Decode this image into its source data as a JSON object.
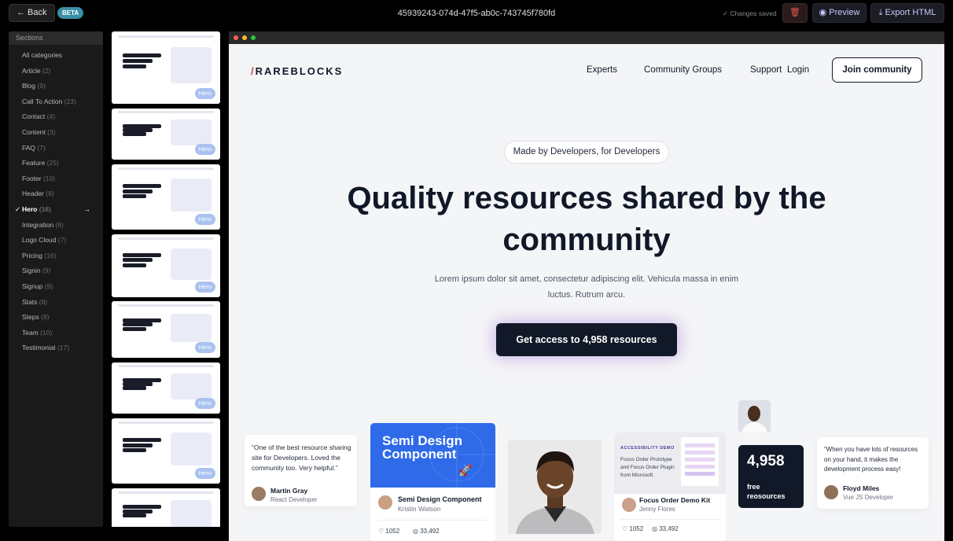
{
  "topbar": {
    "back_label": "← Back",
    "beta": "BETA",
    "doc_id": "45939243-074d-47f5-ab0c-743745f780fd",
    "saved": "✓ Changes saved",
    "trash_icon": "🗑",
    "preview_label": "◉ Preview",
    "export_label": "⤓ Export HTML"
  },
  "sidebar": {
    "header": "Sections",
    "items": [
      {
        "label": "All categories",
        "count": ""
      },
      {
        "label": "Article",
        "count": "(2)"
      },
      {
        "label": "Blog",
        "count": "(9)"
      },
      {
        "label": "Call To Action",
        "count": "(23)"
      },
      {
        "label": "Contact",
        "count": "(4)"
      },
      {
        "label": "Content",
        "count": "(3)"
      },
      {
        "label": "FAQ",
        "count": "(7)"
      },
      {
        "label": "Feature",
        "count": "(25)"
      },
      {
        "label": "Footer",
        "count": "(10)"
      },
      {
        "label": "Header",
        "count": "(8)"
      },
      {
        "label": "Hero",
        "count": "(16)",
        "active": true
      },
      {
        "label": "Integration",
        "count": "(6)"
      },
      {
        "label": "Logo Cloud",
        "count": "(7)"
      },
      {
        "label": "Pricing",
        "count": "(16)"
      },
      {
        "label": "Signin",
        "count": "(9)"
      },
      {
        "label": "Signup",
        "count": "(9)"
      },
      {
        "label": "Stats",
        "count": "(8)"
      },
      {
        "label": "Steps",
        "count": "(8)"
      },
      {
        "label": "Team",
        "count": "(10)"
      },
      {
        "label": "Testimonial",
        "count": "(17)"
      }
    ]
  },
  "thumbnails": {
    "badge": "Hero",
    "items": [
      {
        "title": "Turn your visitors into profitable business"
      },
      {
        "title": "Get meaningful feedbacks on your code"
      },
      {
        "title": "Quality resources shared by the community"
      },
      {
        "title": "A special credit card made for Developers."
      },
      {
        "title": "A special credit card made for Developers."
      },
      {
        "title": "Get meaningful feedbacks on your code"
      },
      {
        "title": "Quality resources shared by the community"
      },
      {
        "title": "A special credit card made for Developers."
      }
    ]
  },
  "preview": {
    "logo_slash": "/",
    "logo": "RAREBLOCKS",
    "nav": [
      "Experts",
      "Community Groups",
      "Support",
      "Login"
    ],
    "join": "Join community",
    "pill": "Made by Developers, for Developers",
    "headline": "Quality resources shared by the community",
    "subtitle": "Lorem ipsum dolor sit amet, consectetur adipiscing elit. Vehicula massa in enim luctus. Rutrum arcu.",
    "cta": "Get access to 4,958 resources",
    "testimonial_left": {
      "quote": "“One of the best resource sharing site for Developers. Loved the community too. Very helpful.”",
      "name": "Martin Gray",
      "role": "React Developer"
    },
    "semi_card": {
      "banner": "Semi Design Component",
      "title": "Semi Design Component",
      "author": "Kristin Watson",
      "likes": "♡ 1052",
      "views": "◎ 33,492"
    },
    "focus_card": {
      "tag": "ACCESSIBILITY DEMO",
      "desc": "Focus Order Prototype and Focus Order Plugin from Microsoft",
      "title": "Focus Order Demo Kit",
      "author": "Jenny Flores",
      "likes": "♡ 1052",
      "views": "◎ 33,492"
    },
    "stat": {
      "value": "4,958",
      "label": "free reosources"
    },
    "testimonial_right": {
      "quote": "“When you have lots of resources on your hand, it makes the development process easy!",
      "name": "Floyd Miles",
      "role": "Vue JS Developer"
    }
  },
  "colors": {
    "accent": "#2f6ae8",
    "dark": "#111827",
    "beta": "#3a8fa8",
    "danger": "#e05656"
  }
}
